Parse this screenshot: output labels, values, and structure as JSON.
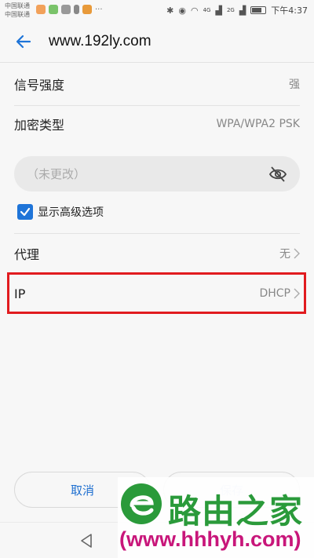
{
  "status_bar": {
    "carrier_1": "中国联通",
    "carrier_2": "中国联通",
    "more": "···",
    "network_1": "4G",
    "network_2": "2G",
    "time": "下午4:37"
  },
  "app_bar": {
    "title": "www.192ly.com"
  },
  "fields": {
    "signal_label": "信号强度",
    "signal_value": "强",
    "security_label": "加密类型",
    "security_value": "WPA/WPA2 PSK"
  },
  "password": {
    "placeholder": "（未更改）"
  },
  "advanced": {
    "label": "显示高级选项",
    "checked": true
  },
  "proxy": {
    "label": "代理",
    "value": "无"
  },
  "ip": {
    "label": "IP",
    "value": "DHCP"
  },
  "actions": {
    "cancel_label": "取消",
    "save_label": "保存"
  },
  "watermark": {
    "brand": "路由之家",
    "url": "(www.hhhyh.com)"
  },
  "colors": {
    "accent": "#1e74d8",
    "highlight": "#e11b1f",
    "brand_green": "#2a9a3a",
    "url_magenta": "#c8167a"
  }
}
